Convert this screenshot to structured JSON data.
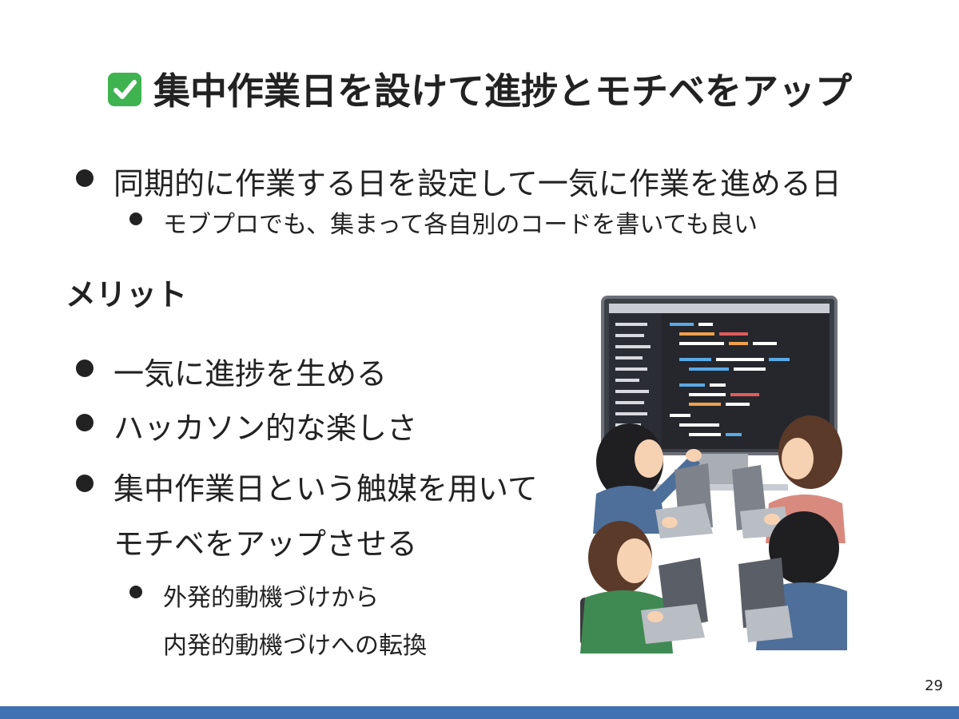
{
  "slide": {
    "title": "集中作業日を設けて進捗とモチベをアップ",
    "title_icon": "check-mark-button-icon",
    "bullets_top": [
      {
        "text": "同期的に作業する日を設定して一気に作業を進める日",
        "level": 1
      },
      {
        "text": "モブプロでも、集まって各自別のコードを書いても良い",
        "level": 2
      }
    ],
    "merit_heading": "メリット",
    "bullets_merit": [
      {
        "text": "一気に進捗を生める",
        "level": 1
      },
      {
        "text": "ハッカソン的な楽しさ",
        "level": 1
      },
      {
        "text": "集中作業日という触媒を用いて",
        "level": 1
      },
      {
        "text": "モチベをアップさせる",
        "level": 1,
        "continuation": true
      },
      {
        "text": "外発的動機づけから",
        "level": 2
      },
      {
        "text": "内発的動機づけへの転換",
        "level": 2,
        "continuation": true
      }
    ],
    "page_number": "29",
    "illustration": "team-coding-hackathon-illustration",
    "colors": {
      "footer_bar": "#4271b3",
      "check_green": "#3fb34f",
      "text": "#222222"
    }
  }
}
